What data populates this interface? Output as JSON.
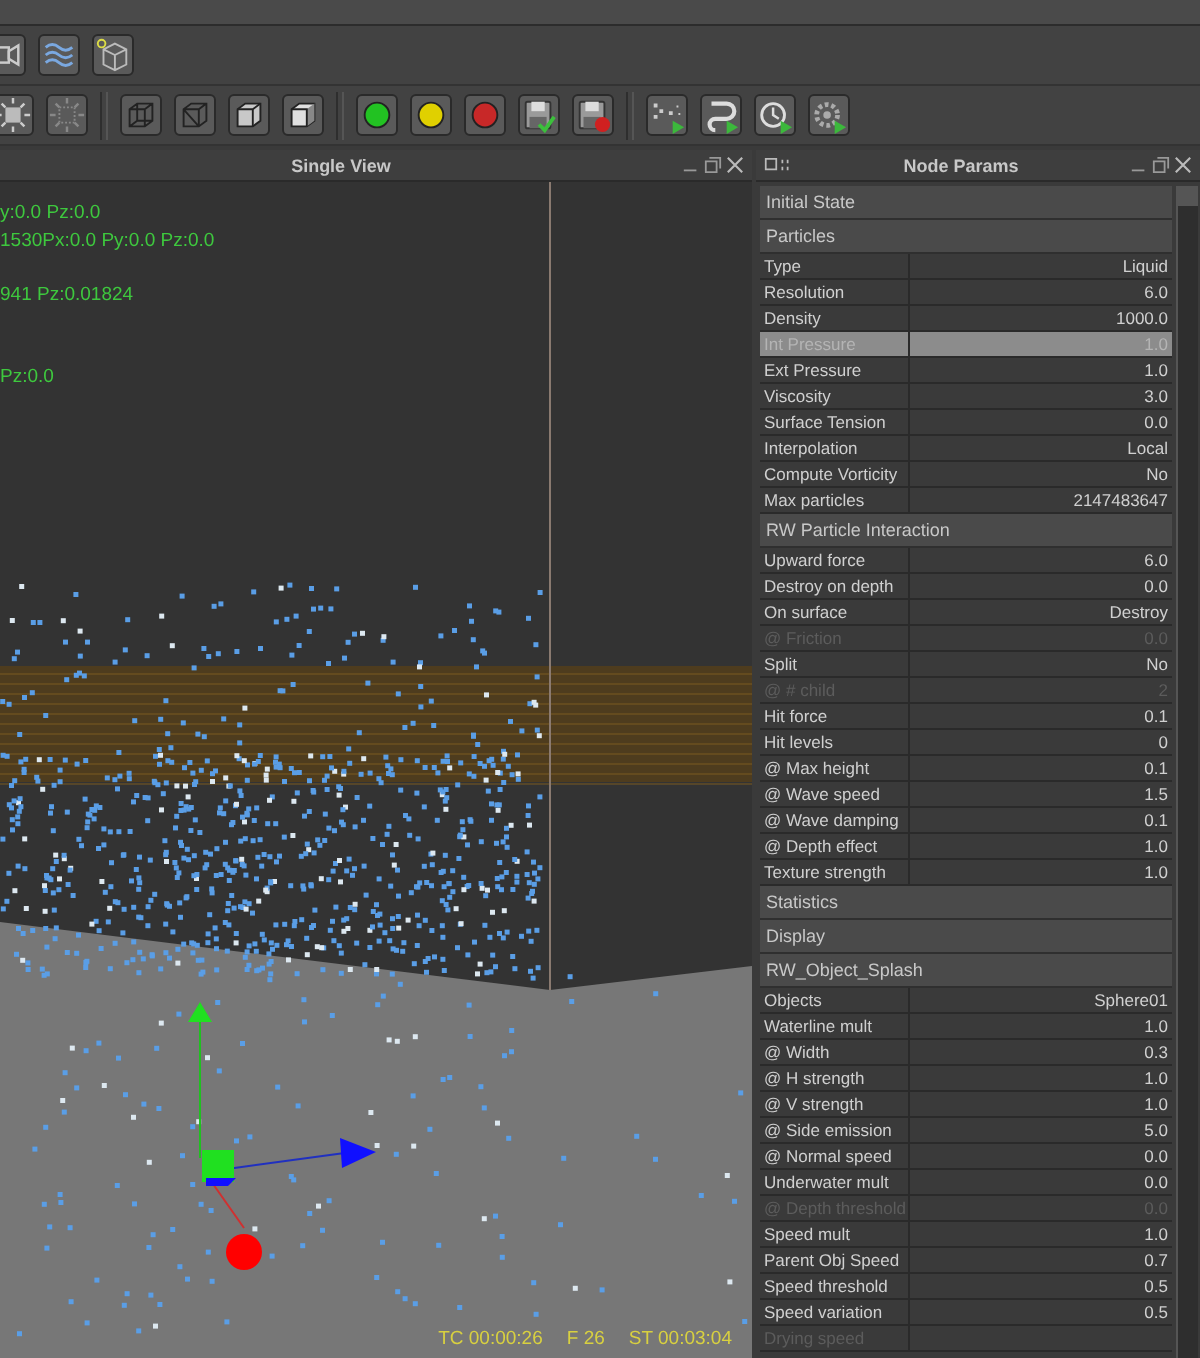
{
  "toolbar_rows": [
    {
      "buttons": [
        {
          "kind": "camera"
        },
        {
          "kind": "waves"
        },
        {
          "kind": "cube-dot"
        }
      ]
    },
    {
      "buttons": [
        {
          "kind": "burst"
        },
        {
          "kind": "burst-faint"
        },
        {
          "kind": "separator"
        },
        {
          "kind": "cube-wire"
        },
        {
          "kind": "cube-diag"
        },
        {
          "kind": "cube-solid"
        },
        {
          "kind": "cube-shaded"
        },
        {
          "kind": "separator"
        },
        {
          "kind": "light",
          "color": "#22c222"
        },
        {
          "kind": "light",
          "color": "#e0d000"
        },
        {
          "kind": "light",
          "color": "#c82828"
        },
        {
          "kind": "save-check"
        },
        {
          "kind": "save-delete"
        },
        {
          "kind": "separator"
        },
        {
          "kind": "dots-play"
        },
        {
          "kind": "loop-play"
        },
        {
          "kind": "clock-play"
        },
        {
          "kind": "gear-play"
        }
      ]
    }
  ],
  "viewport": {
    "title": "Single View",
    "readouts": [
      "y:0.0 Pz:0.0",
      "1530Px:0.0 Py:0.0 Pz:0.0",
      "941 Pz:0.01824",
      "Pz:0.0"
    ],
    "timecode": "TC 00:00:26",
    "frame": "F 26",
    "scene_time": "ST 00:03:04"
  },
  "node_params": {
    "title": "Node Params",
    "sections": [
      {
        "title": "Initial State"
      },
      {
        "title": "Particles",
        "rows": [
          {
            "label": "Type",
            "value": "Liquid",
            "selected": false,
            "disabled": false
          },
          {
            "label": "Resolution",
            "value": "6.0",
            "selected": false,
            "disabled": false
          },
          {
            "label": "Density",
            "value": "1000.0",
            "selected": false,
            "disabled": false
          },
          {
            "label": "Int Pressure",
            "value": "1.0",
            "selected": true,
            "disabled": false
          },
          {
            "label": "Ext Pressure",
            "value": "1.0",
            "selected": false,
            "disabled": false
          },
          {
            "label": "Viscosity",
            "value": "3.0",
            "selected": false,
            "disabled": false
          },
          {
            "label": "Surface Tension",
            "value": "0.0",
            "selected": false,
            "disabled": false
          },
          {
            "label": "Interpolation",
            "value": "Local",
            "selected": false,
            "disabled": false
          },
          {
            "label": "Compute Vorticity",
            "value": "No",
            "selected": false,
            "disabled": false
          },
          {
            "label": "Max particles",
            "value": "2147483647",
            "selected": false,
            "disabled": false
          }
        ]
      },
      {
        "title": "RW Particle Interaction",
        "rows": [
          {
            "label": "Upward force",
            "value": "6.0",
            "selected": false,
            "disabled": false
          },
          {
            "label": "Destroy on depth",
            "value": "0.0",
            "selected": false,
            "disabled": false
          },
          {
            "label": "On surface",
            "value": "Destroy",
            "selected": false,
            "disabled": false
          },
          {
            "label": "@ Friction",
            "value": "0.0",
            "selected": false,
            "disabled": true
          },
          {
            "label": "Split",
            "value": "No",
            "selected": false,
            "disabled": false
          },
          {
            "label": "@ # child",
            "value": "2",
            "selected": false,
            "disabled": true
          },
          {
            "label": "Hit force",
            "value": "0.1",
            "selected": false,
            "disabled": false
          },
          {
            "label": "Hit levels",
            "value": "0",
            "selected": false,
            "disabled": false
          },
          {
            "label": "@ Max height",
            "value": "0.1",
            "selected": false,
            "disabled": false
          },
          {
            "label": "@ Wave speed",
            "value": "1.5",
            "selected": false,
            "disabled": false
          },
          {
            "label": "@ Wave damping",
            "value": "0.1",
            "selected": false,
            "disabled": false
          },
          {
            "label": "@ Depth effect",
            "value": "1.0",
            "selected": false,
            "disabled": false
          },
          {
            "label": "Texture strength",
            "value": "1.0",
            "selected": false,
            "disabled": false
          }
        ]
      },
      {
        "title": "Statistics"
      },
      {
        "title": "Display"
      },
      {
        "title": "RW_Object_Splash",
        "rows": [
          {
            "label": "Objects",
            "value": "Sphere01",
            "selected": false,
            "disabled": false
          },
          {
            "label": "Waterline mult",
            "value": "1.0",
            "selected": false,
            "disabled": false
          },
          {
            "label": "@ Width",
            "value": "0.3",
            "selected": false,
            "disabled": false
          },
          {
            "label": "@ H strength",
            "value": "1.0",
            "selected": false,
            "disabled": false
          },
          {
            "label": "@ V strength",
            "value": "1.0",
            "selected": false,
            "disabled": false
          },
          {
            "label": "@ Side emission",
            "value": "5.0",
            "selected": false,
            "disabled": false
          },
          {
            "label": "@ Normal speed",
            "value": "0.0",
            "selected": false,
            "disabled": false
          },
          {
            "label": "Underwater mult",
            "value": "0.0",
            "selected": false,
            "disabled": false
          },
          {
            "label": "@ Depth threshold",
            "value": "0.0",
            "selected": false,
            "disabled": true
          },
          {
            "label": "Speed mult",
            "value": "1.0",
            "selected": false,
            "disabled": false
          },
          {
            "label": "Parent Obj Speed",
            "value": "0.7",
            "selected": false,
            "disabled": false
          },
          {
            "label": "Speed threshold",
            "value": "0.5",
            "selected": false,
            "disabled": false
          },
          {
            "label": "Speed variation",
            "value": "0.5",
            "selected": false,
            "disabled": false
          },
          {
            "label": "Drying speed",
            "selected": false,
            "disabled": true
          }
        ]
      }
    ]
  }
}
